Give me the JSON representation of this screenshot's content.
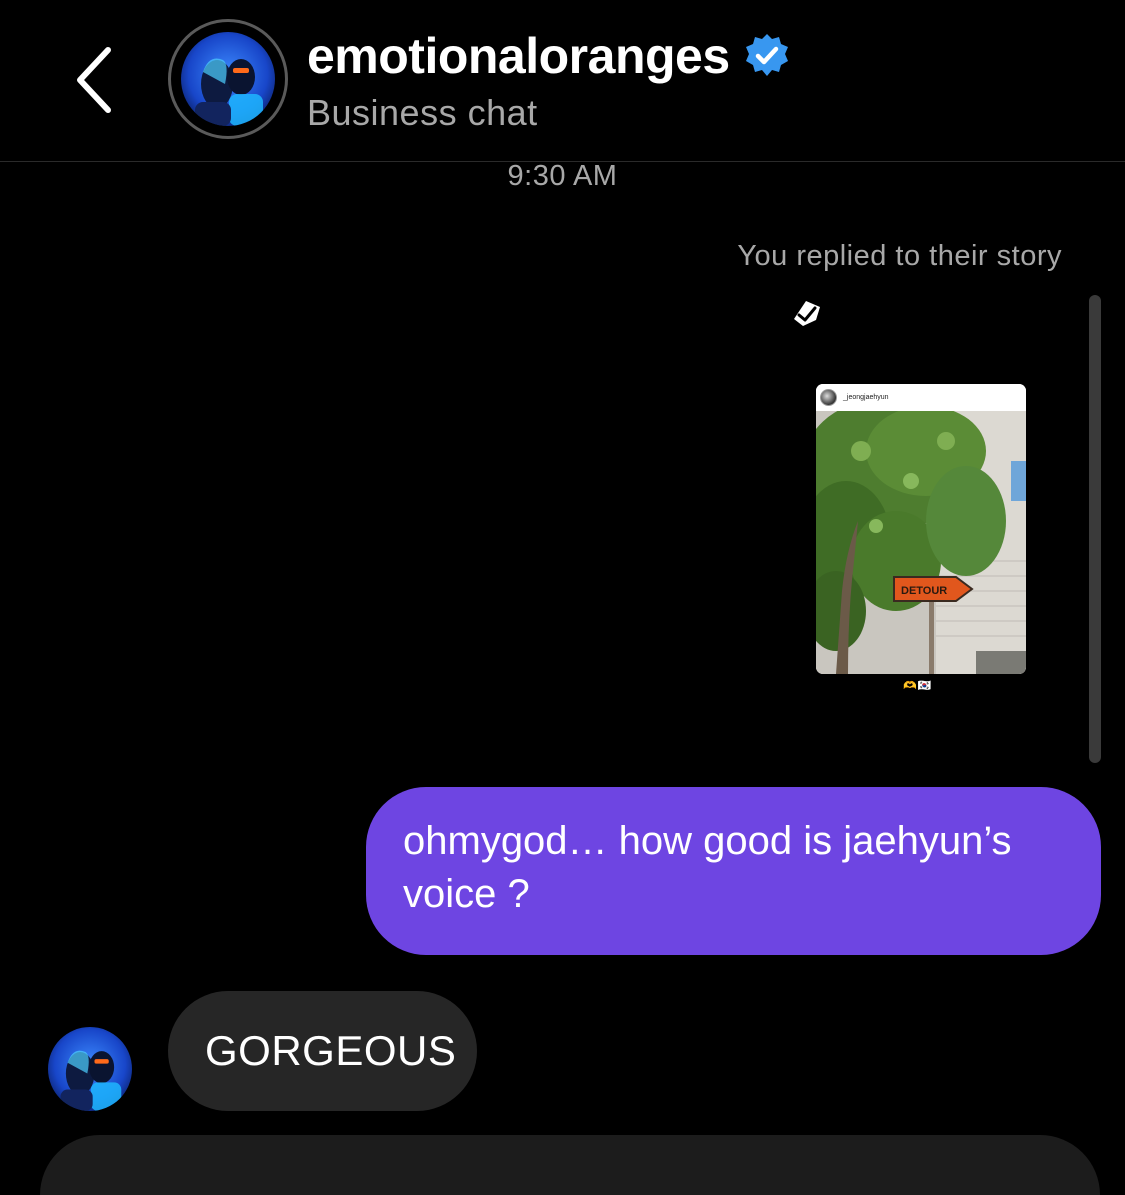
{
  "header": {
    "back_icon": "chevron-left-icon",
    "username": "emotionaloranges",
    "subtitle": "Business chat",
    "verified_icon": "verified-badge-icon",
    "verified_color": "#3897f0"
  },
  "thread": {
    "timestamp": "9:30 AM",
    "reply_note": "You replied to their story",
    "story": {
      "username": "_jeongjaehyun",
      "sign_text": "DETOUR",
      "reaction_emojis": "🫶🇰🇷"
    },
    "outgoing_message": "ohmygod… how good is jaehyun’s voice ?",
    "incoming_message": "GORGEOUS"
  },
  "colors": {
    "outgoing_bubble": "#6e45e2",
    "incoming_bubble": "#262626",
    "background": "#000000"
  }
}
